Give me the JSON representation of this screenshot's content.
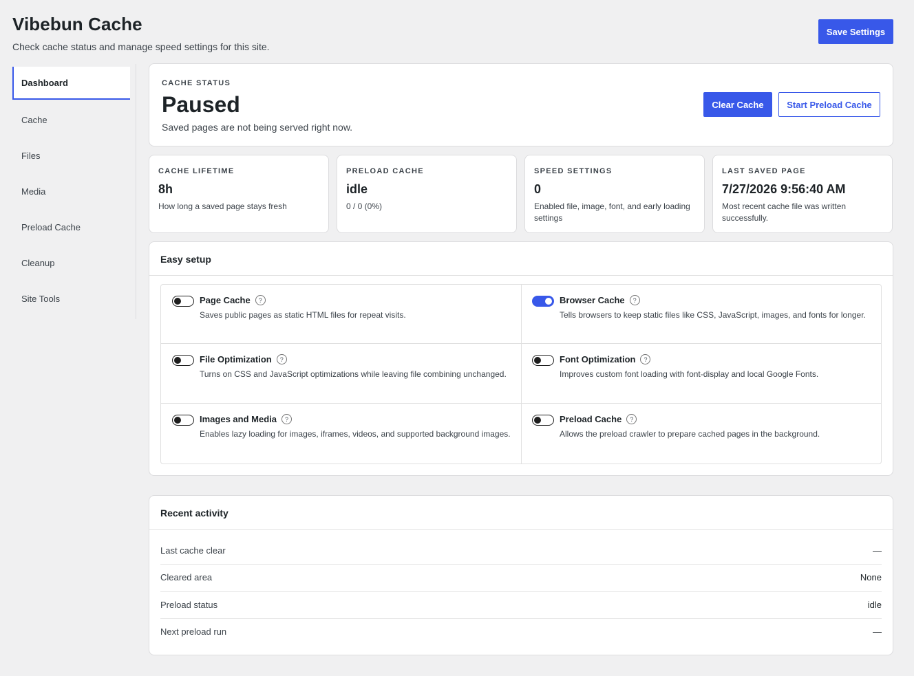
{
  "header": {
    "title": "Vibebun Cache",
    "subtitle": "Check cache status and manage speed settings for this site.",
    "save_label": "Save Settings"
  },
  "sidebar": {
    "items": [
      {
        "label": "Dashboard",
        "active": true
      },
      {
        "label": "Cache"
      },
      {
        "label": "Files"
      },
      {
        "label": "Media"
      },
      {
        "label": "Preload Cache"
      },
      {
        "label": "Cleanup"
      },
      {
        "label": "Site Tools"
      }
    ]
  },
  "status": {
    "eyebrow": "CACHE STATUS",
    "value": "Paused",
    "description": "Saved pages are not being served right now.",
    "clear_label": "Clear Cache",
    "preload_label": "Start Preload Cache"
  },
  "stats": [
    {
      "label": "CACHE LIFETIME",
      "value": "8h",
      "description": "How long a saved page stays fresh"
    },
    {
      "label": "PRELOAD CACHE",
      "value": "idle",
      "description": "0 / 0 (0%)"
    },
    {
      "label": "SPEED SETTINGS",
      "value": "0",
      "description": "Enabled file, image, font, and early loading settings"
    },
    {
      "label": "LAST SAVED PAGE",
      "value": "7/27/2026 9:56:40 AM",
      "description": "Most recent cache file was written successfully."
    }
  ],
  "setup": {
    "title": "Easy setup",
    "help_glyph": "?",
    "options": [
      {
        "title": "Page Cache",
        "description": "Saves public pages as static HTML files for repeat visits.",
        "enabled": false
      },
      {
        "title": "Browser Cache",
        "description": "Tells browsers to keep static files like CSS, JavaScript, images, and fonts for longer.",
        "enabled": true
      },
      {
        "title": "File Optimization",
        "description": "Turns on CSS and JavaScript optimizations while leaving file combining unchanged.",
        "enabled": false
      },
      {
        "title": "Font Optimization",
        "description": "Improves custom font loading with font-display and local Google Fonts.",
        "enabled": false
      },
      {
        "title": "Images and Media",
        "description": "Enables lazy loading for images, iframes, videos, and supported background images.",
        "enabled": false
      },
      {
        "title": "Preload Cache",
        "description": "Allows the preload crawler to prepare cached pages in the background.",
        "enabled": false
      }
    ]
  },
  "activity": {
    "title": "Recent activity",
    "rows": [
      {
        "label": "Last cache clear",
        "value": "—"
      },
      {
        "label": "Cleared area",
        "value": "None"
      },
      {
        "label": "Preload status",
        "value": "idle"
      },
      {
        "label": "Next preload run",
        "value": "—"
      }
    ]
  },
  "colors": {
    "accent": "#3858e9",
    "background": "#f0f0f1",
    "text": "#1d2327"
  }
}
